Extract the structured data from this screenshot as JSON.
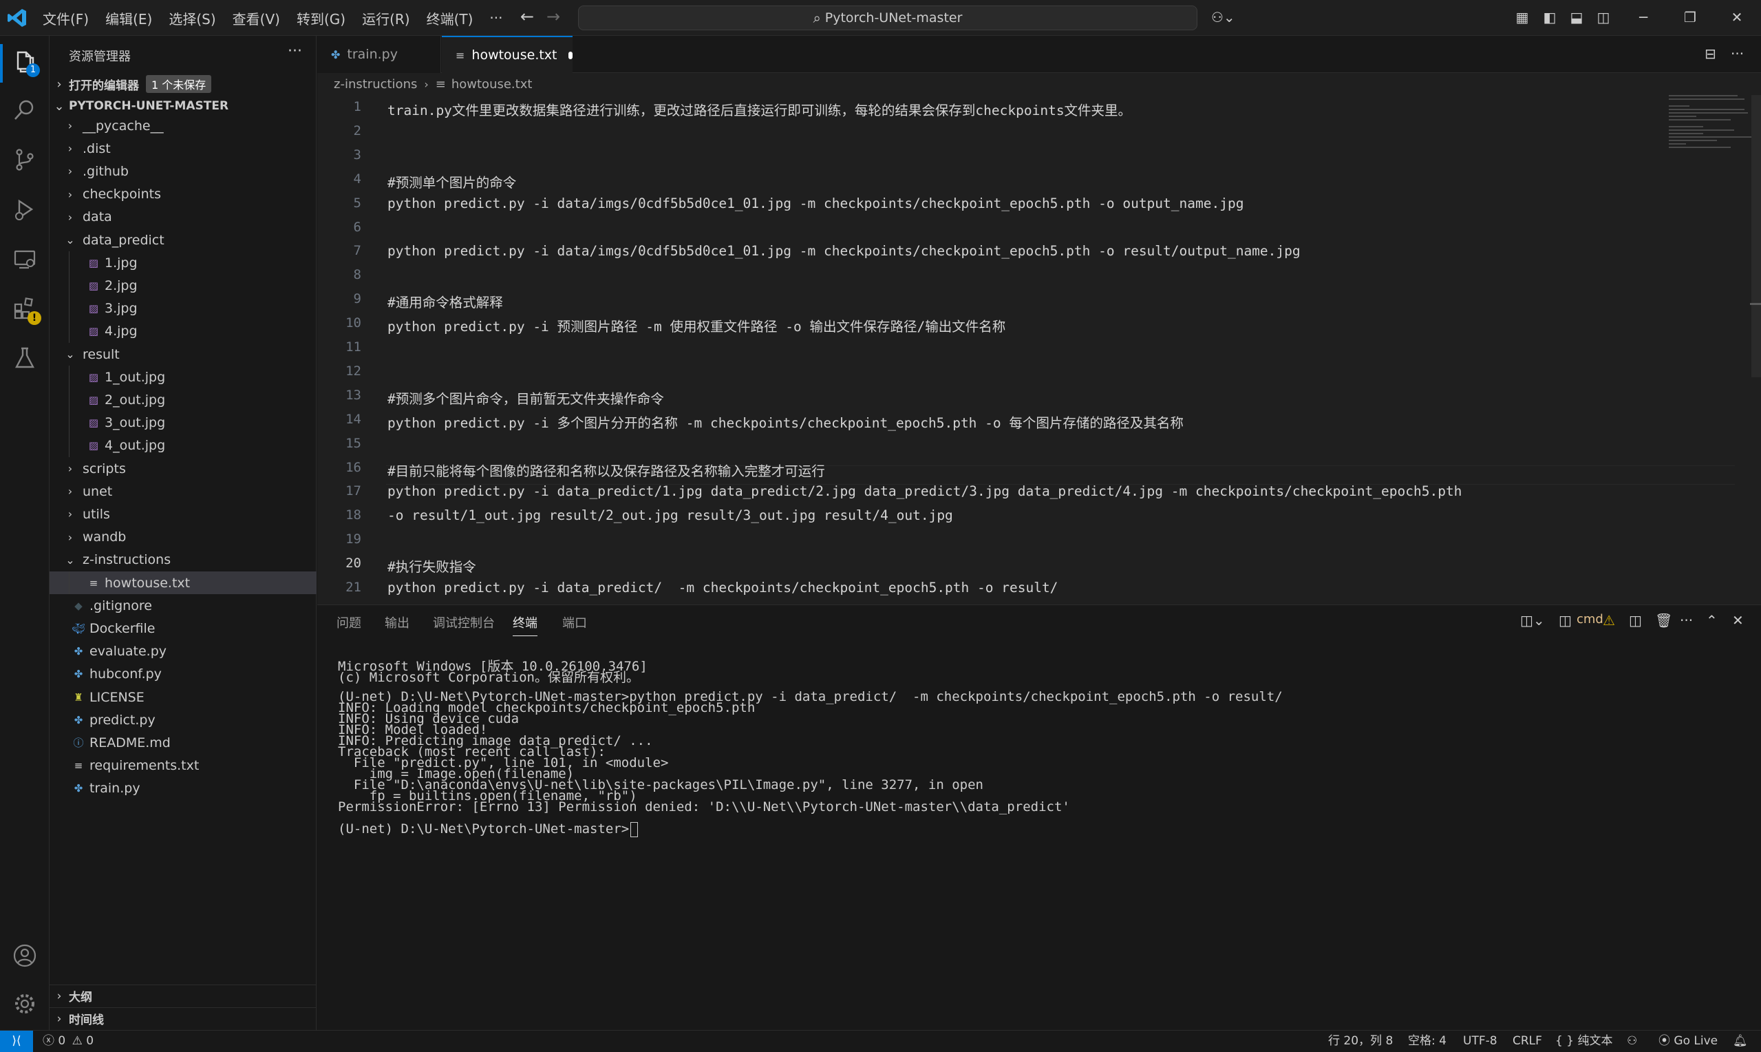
{
  "titlebar": {
    "menu": [
      "文件(F)",
      "编辑(E)",
      "选择(S)",
      "查看(V)",
      "转到(G)",
      "运行(R)",
      "终端(T)",
      "···"
    ],
    "search_text": "Pytorch-UNet-master"
  },
  "activitybar": {
    "explorer_badge": "1",
    "extensions_badge": "!"
  },
  "sidebar": {
    "title": "资源管理器",
    "more": "···",
    "open_editors": "打开的编辑器",
    "unsaved": "1 个未保存",
    "project": "PYTORCH-UNET-MASTER",
    "tree": [
      {
        "label": "__pycache__",
        "type": "folder",
        "open": false,
        "depth": 1
      },
      {
        "label": ".dist",
        "type": "folder",
        "open": false,
        "depth": 1
      },
      {
        "label": ".github",
        "type": "folder",
        "open": false,
        "depth": 1
      },
      {
        "label": "checkpoints",
        "type": "folder",
        "open": false,
        "depth": 1
      },
      {
        "label": "data",
        "type": "folder",
        "open": false,
        "depth": 1
      },
      {
        "label": "data_predict",
        "type": "folder",
        "open": true,
        "depth": 1
      },
      {
        "label": "1.jpg",
        "type": "image",
        "depth": 2
      },
      {
        "label": "2.jpg",
        "type": "image",
        "depth": 2
      },
      {
        "label": "3.jpg",
        "type": "image",
        "depth": 2
      },
      {
        "label": "4.jpg",
        "type": "image",
        "depth": 2
      },
      {
        "label": "result",
        "type": "folder",
        "open": true,
        "depth": 1
      },
      {
        "label": "1_out.jpg",
        "type": "image",
        "depth": 2
      },
      {
        "label": "2_out.jpg",
        "type": "image",
        "depth": 2
      },
      {
        "label": "3_out.jpg",
        "type": "image",
        "depth": 2
      },
      {
        "label": "4_out.jpg",
        "type": "image",
        "depth": 2
      },
      {
        "label": "scripts",
        "type": "folder",
        "open": false,
        "depth": 1
      },
      {
        "label": "unet",
        "type": "folder",
        "open": false,
        "depth": 1
      },
      {
        "label": "utils",
        "type": "folder",
        "open": false,
        "depth": 1
      },
      {
        "label": "wandb",
        "type": "folder",
        "open": false,
        "depth": 1
      },
      {
        "label": "z-instructions",
        "type": "folder",
        "open": true,
        "depth": 1
      },
      {
        "label": "howtouse.txt",
        "type": "text",
        "depth": 2,
        "selected": true
      },
      {
        "label": ".gitignore",
        "type": "git",
        "depth": 1
      },
      {
        "label": "Dockerfile",
        "type": "docker",
        "depth": 1
      },
      {
        "label": "evaluate.py",
        "type": "python",
        "depth": 1
      },
      {
        "label": "hubconf.py",
        "type": "python",
        "depth": 1
      },
      {
        "label": "LICENSE",
        "type": "license",
        "depth": 1
      },
      {
        "label": "predict.py",
        "type": "python",
        "depth": 1
      },
      {
        "label": "README.md",
        "type": "info",
        "depth": 1
      },
      {
        "label": "requirements.txt",
        "type": "text",
        "depth": 1
      },
      {
        "label": "train.py",
        "type": "python",
        "depth": 1
      }
    ],
    "outline": "大纲",
    "timeline": "时间线"
  },
  "tabs": [
    {
      "label": "train.py",
      "icon": "python-icon"
    },
    {
      "label": "howtouse.txt",
      "icon": "text-file-icon",
      "dirty": true
    }
  ],
  "breadcrumb": {
    "folder": "z-instructions",
    "file": "howtouse.txt"
  },
  "editor": {
    "current_line": 20,
    "lines": [
      "train.py文件里更改数据集路径进行训练，更改过路径后直接运行即可训练，每轮的结果会保存到checkpoints文件夹里。",
      "",
      "",
      "#预测单个图片的命令",
      "python predict.py -i data/imgs/0cdf5b5d0ce1_01.jpg -m checkpoints/checkpoint_epoch5.pth -o output_name.jpg",
      "",
      "python predict.py -i data/imgs/0cdf5b5d0ce1_01.jpg -m checkpoints/checkpoint_epoch5.pth -o result/output_name.jpg",
      "",
      "#通用命令格式解释",
      "python predict.py -i 预测图片路径 -m 使用权重文件路径 -o 输出文件保存路径/输出文件名称",
      "",
      "",
      "#预测多个图片命令，目前暂无文件夹操作命令",
      "python predict.py -i 多个图片分开的名称 -m checkpoints/checkpoint_epoch5.pth -o 每个图片存储的路径及其名称",
      "",
      "#目前只能将每个图像的路径和名称以及保存路径及名称输入完整才可运行",
      "python predict.py -i data_predict/1.jpg data_predict/2.jpg data_predict/3.jpg data_predict/4.jpg -m checkpoints/checkpoint_epoch5.pth",
      "-o result/1_out.jpg result/2_out.jpg result/3_out.jpg result/4_out.jpg",
      "",
      "#执行失败指令",
      "python predict.py -i data_predict/  -m checkpoints/checkpoint_epoch5.pth -o result/"
    ]
  },
  "panel": {
    "tabs": [
      "问题",
      "输出",
      "调试控制台",
      "终端",
      "端口"
    ],
    "active_tab": "终端",
    "terminal_name": "cmd",
    "terminal_lines": [
      "Microsoft Windows [版本 10.0.26100.3476]",
      "(c) Microsoft Corporation。保留所有权利。",
      "",
      "(U-net) D:\\U-Net\\Pytorch-UNet-master>python predict.py -i data_predict/  -m checkpoints/checkpoint_epoch5.pth -o result/",
      "INFO: Loading model checkpoints/checkpoint_epoch5.pth",
      "INFO: Using device cuda",
      "INFO: Model loaded!",
      "INFO: Predicting image data_predict/ ...",
      "Traceback (most recent call last):",
      "  File \"predict.py\", line 101, in <module>",
      "    img = Image.open(filename)",
      "  File \"D:\\anaconda\\envs\\U-net\\lib\\site-packages\\PIL\\Image.py\", line 3277, in open",
      "    fp = builtins.open(filename, \"rb\")",
      "PermissionError: [Errno 13] Permission denied: 'D:\\\\U-Net\\\\Pytorch-UNet-master\\\\data_predict'",
      ""
    ],
    "prompt": "(U-net) D:\\U-Net\\Pytorch-UNet-master>"
  },
  "statusbar": {
    "errors": "0",
    "warnings": "0",
    "position": "行 20，列 8",
    "spaces": "空格: 4",
    "encoding": "UTF-8",
    "eol": "CRLF",
    "language": "{ } 纯文本",
    "golive": "Go Live"
  }
}
